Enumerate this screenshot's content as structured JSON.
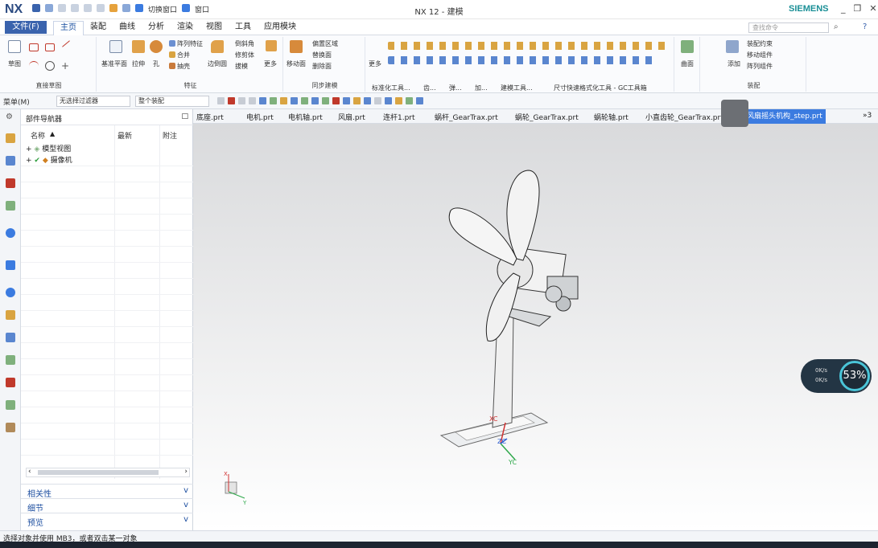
{
  "app": {
    "logo": "NX",
    "window_title": "NX 12 - 建模",
    "brand": "SIEMENS",
    "qat_switch": "切换窗口",
    "qat_window": "窗口"
  },
  "menu": {
    "file": "文件(F)",
    "tabs": [
      "主页",
      "装配",
      "曲线",
      "分析",
      "渲染",
      "视图",
      "工具",
      "应用模块"
    ],
    "search_placeholder": "查找命令"
  },
  "ribbon": {
    "groups": [
      "直接草图",
      "特征",
      "同步建模",
      "标准化工具...",
      "齿...",
      "弹...",
      "加...",
      "建模工具...",
      "尺寸快速格式化工具 - GC工具箱",
      "装配"
    ],
    "buttons": [
      "草图",
      "基准平面",
      "拉伸",
      "孔",
      "阵列特征",
      "合并",
      "抽壳",
      "边倒圆",
      "倒斜角",
      "修剪体",
      "拔模",
      "更多",
      "移动面",
      "偏置区域",
      "替换面",
      "删除面",
      "更多",
      "曲面",
      "添加",
      "装配约束",
      "移动组件",
      "阵列组件"
    ]
  },
  "selectionbar": {
    "menu": "菜单(M)",
    "filter": "无选择过滤器",
    "scope": "整个装配"
  },
  "navigator": {
    "title": "部件导航器",
    "col_name": "名称",
    "col_latest": "最新",
    "col_note": "附注",
    "rows": [
      "模型视图",
      "摄像机"
    ],
    "panels": [
      {
        "label": "相关性"
      },
      {
        "label": "细节"
      },
      {
        "label": "预览"
      }
    ]
  },
  "file_tabs": [
    "底座.prt",
    "电机.prt",
    "电机轴.prt",
    "风扇.prt",
    "连杆1.prt",
    "蜗杆_GearTrax.prt",
    "蜗轮_GearTrax.prt",
    "蜗轮轴.prt",
    "小直齿轮_GearTrax.prt",
    "风扇摇头机构_step.prt"
  ],
  "file_tabs_more": "»3",
  "viewport": {
    "label_xc": "XC",
    "label_yc": "YC",
    "label_zc": "ZC",
    "triad_x": "X",
    "triad_y": "Y"
  },
  "network": {
    "up": "0K/s",
    "down": "0K/s",
    "cpu_percent": "53%"
  },
  "status": {
    "text": "选择对象并使用 MB3，或者双击某一对象"
  },
  "colors": {
    "accent": "#3a63ad",
    "active_tab": "#3b7be0",
    "brand": "#1a8f96"
  }
}
